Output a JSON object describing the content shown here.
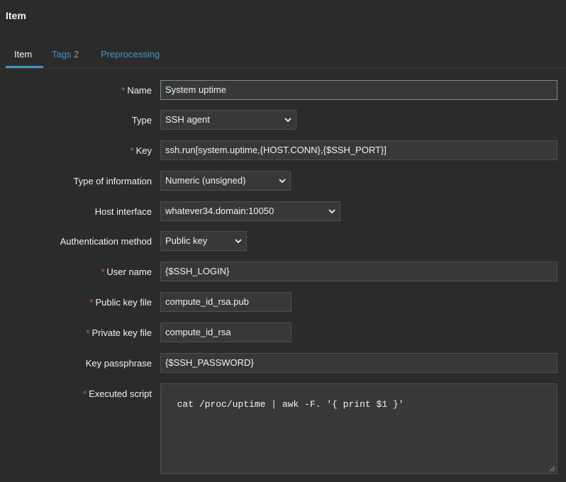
{
  "header": {
    "title": "Item"
  },
  "tabs": [
    {
      "label": "Item"
    },
    {
      "label": "Tags",
      "count": "2"
    },
    {
      "label": "Preprocessing"
    }
  ],
  "form": {
    "name": {
      "label": "Name",
      "value": "System uptime"
    },
    "type": {
      "label": "Type",
      "value": "SSH agent"
    },
    "key": {
      "label": "Key",
      "value": "ssh.run[system.uptime,{HOST.CONN},{$SSH_PORT}]"
    },
    "type_of_information": {
      "label": "Type of information",
      "value": "Numeric (unsigned)"
    },
    "host_interface": {
      "label": "Host interface",
      "value": "whatever34.domain:10050"
    },
    "authentication_method": {
      "label": "Authentication method",
      "value": "Public key"
    },
    "user_name": {
      "label": "User name",
      "value": "{$SSH_LOGIN}"
    },
    "public_key_file": {
      "label": "Public key file",
      "value": "compute_id_rsa.pub"
    },
    "private_key_file": {
      "label": "Private key file",
      "value": "compute_id_rsa"
    },
    "key_passphrase": {
      "label": "Key passphrase",
      "value": "{$SSH_PASSWORD}"
    },
    "executed_script": {
      "label": "Executed script",
      "value": "cat /proc/uptime | awk -F. '{ print $1 }'"
    }
  },
  "required_marker": "*",
  "colors": {
    "background": "#2b2b2b",
    "field": "#383838",
    "accent": "#4796c4",
    "required": "#e45959"
  }
}
